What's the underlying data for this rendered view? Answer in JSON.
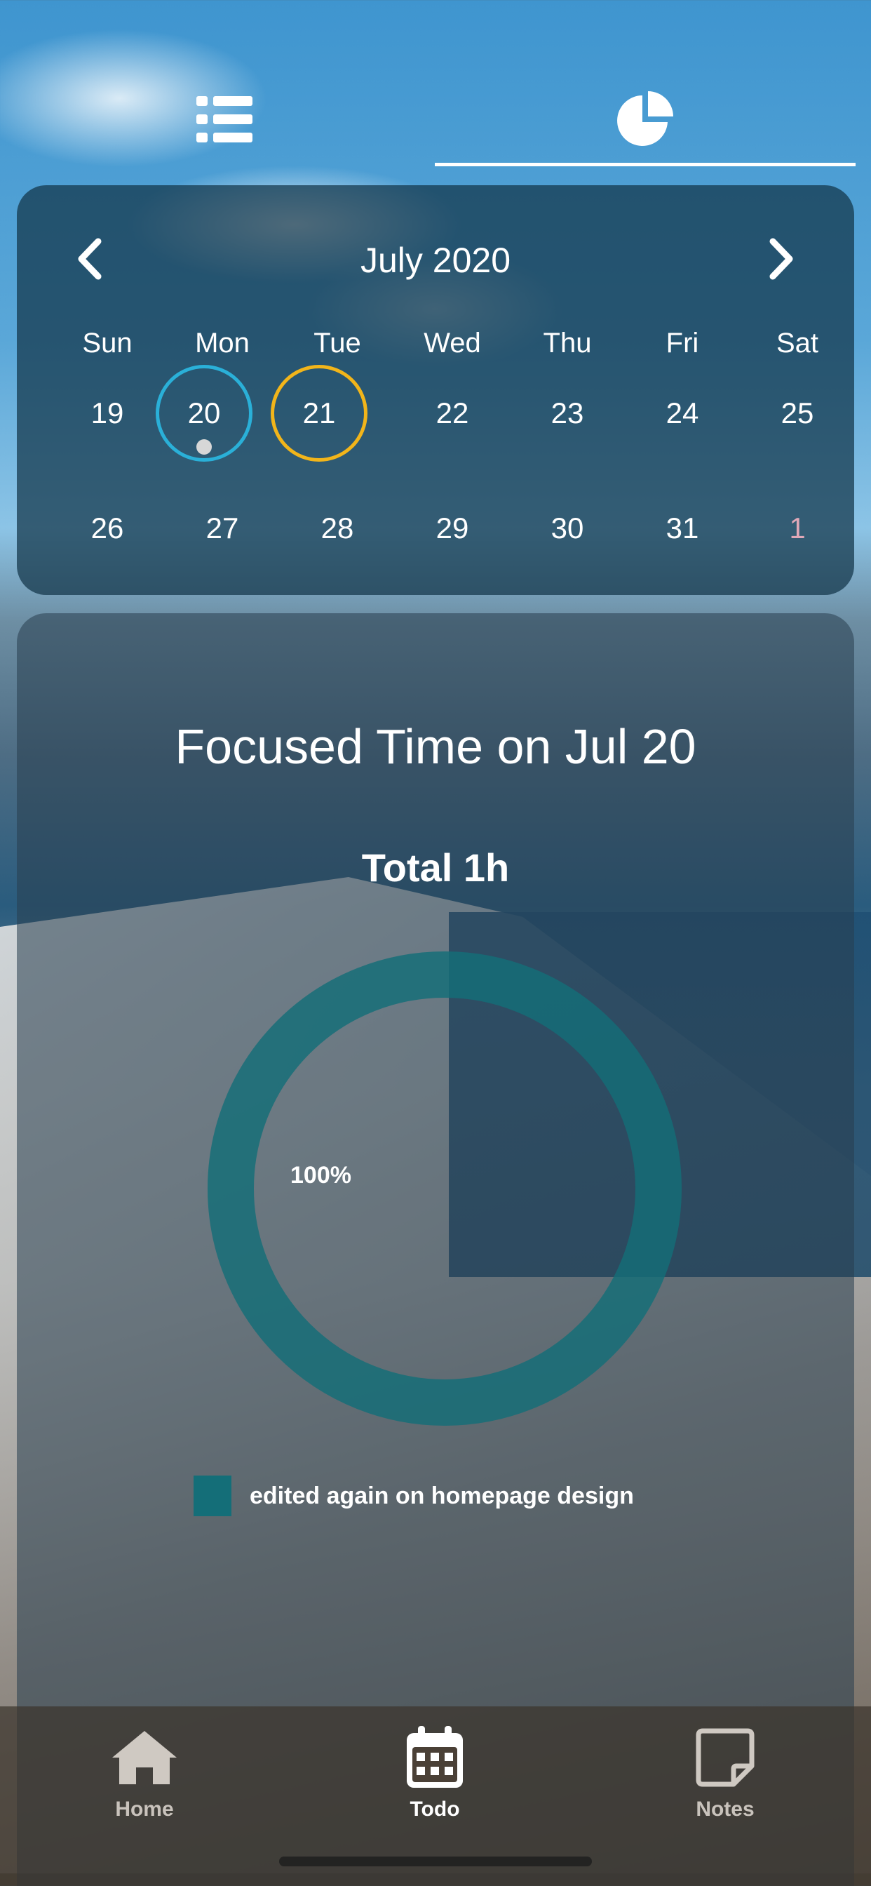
{
  "top_tabs": {
    "items": [
      {
        "icon": "list-icon",
        "active": false
      },
      {
        "icon": "pie-chart-icon",
        "active": true
      }
    ]
  },
  "calendar": {
    "month_title": "July 2020",
    "prev_icon": "chevron-left-icon",
    "next_icon": "chevron-right-icon",
    "weekdays": [
      "Sun",
      "Mon",
      "Tue",
      "Wed",
      "Thu",
      "Fri",
      "Sat"
    ],
    "weeks": [
      [
        "19",
        "20",
        "21",
        "22",
        "23",
        "24",
        "25"
      ],
      [
        "26",
        "27",
        "28",
        "29",
        "30",
        "31",
        "1"
      ]
    ],
    "selected_day": "20",
    "today": "21",
    "selected_color": "#2ab0d8",
    "today_color": "#f2b51a",
    "next_month_day_color": "#e0a8b8"
  },
  "focus": {
    "title": "Focused Time on Jul 20",
    "total": "Total 1h",
    "percent_label": "100%",
    "legend_label": "edited again on homepage design",
    "segment_color": "#146e78"
  },
  "chart_data": {
    "type": "pie",
    "categories": [
      "edited again on homepage design"
    ],
    "values": [
      100
    ],
    "title": "Focused Time on Jul 20"
  },
  "bottom_nav": {
    "home": "Home",
    "todo": "Todo",
    "notes": "Notes",
    "active": "Todo"
  }
}
